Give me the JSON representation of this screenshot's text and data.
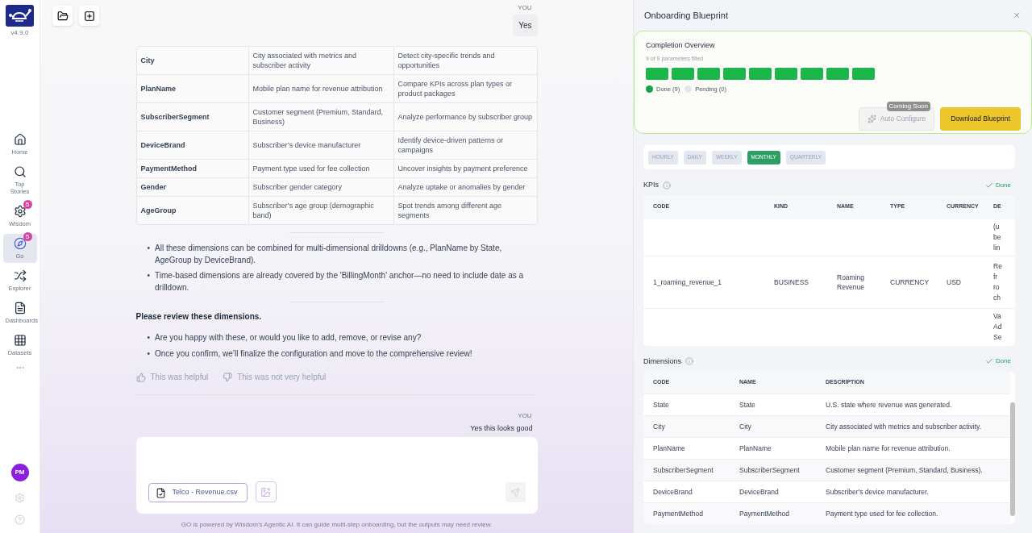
{
  "sidebar": {
    "version": "v4.9.0",
    "nav": [
      {
        "label": "Home",
        "selected": false
      },
      {
        "label": "Top Stories",
        "selected": false
      },
      {
        "label": "Wisdom",
        "badge": "5",
        "selected": false
      },
      {
        "label": "Go",
        "badge": "5",
        "selected": true
      },
      {
        "label": "Explorer",
        "selected": false
      },
      {
        "label": "Dashboards",
        "selected": false
      },
      {
        "label": "Datasets",
        "selected": false
      }
    ],
    "avatar": "PM"
  },
  "chat": {
    "first_message": {
      "sender": "YOU",
      "text": "Yes"
    },
    "table": {
      "rows": [
        [
          "City",
          "City associated with metrics and subscriber activity",
          "Detect city-specific trends and opportunities"
        ],
        [
          "PlanName",
          "Mobile plan name for revenue attribution",
          "Compare KPIs across plan types or product packages"
        ],
        [
          "SubscriberSegment",
          "Customer segment (Premium, Standard, Business)",
          "Analyze performance by subscriber group"
        ],
        [
          "DeviceBrand",
          "Subscriber’s device manufacturer",
          "Identify device-driven patterns or campaigns"
        ],
        [
          "PaymentMethod",
          "Payment type used for fee collection",
          "Uncover insights by payment preference"
        ],
        [
          "Gender",
          "Subscriber gender category",
          "Analyze uptake or anomalies by gender"
        ],
        [
          "AgeGroup",
          "Subscriber’s age group (demographic band)",
          "Spot trends among different age segments"
        ]
      ]
    },
    "notes": [
      {
        "marker": "•",
        "text": "All these dimensions can be combined for multi-dimensional drilldowns (e.g., PlanName by State, AgeGroup by DeviceBrand)."
      },
      {
        "marker": "•",
        "text": "Time-based dimensions are already covered by the 'BillingMonth' anchor—no need to include date as a drilldown."
      }
    ],
    "review_heading": "Please review these dimensions.",
    "review_points": [
      {
        "marker": "•",
        "text": "Are you happy with these, or would you like to add, remove, or revise any?"
      },
      {
        "marker": "•",
        "text": "Once you confirm, we’ll finalize the configuration and move to the comprehensive review!"
      }
    ],
    "feedback": [
      {
        "label": "This was helpful"
      },
      {
        "label": "This was not very helpful"
      }
    ],
    "last_message": {
      "sender": "YOU",
      "text": "Yes this looks good"
    }
  },
  "composer": {
    "attachment": "Telco - Revenue.csv",
    "send_disabled": true
  },
  "footer": "GO is powered by Wisdom’s Agentic AI. It can guide multi-step onboarding, but the outputs may need review.",
  "panel": {
    "title": "Onboarding Blueprint",
    "completion": {
      "title": "Completion Overview",
      "subtitle": "9 of 9 parameters filled",
      "segments": [
        {
          "done": true
        },
        {
          "done": true
        },
        {
          "done": true
        },
        {
          "done": true
        },
        {
          "done": true
        },
        {
          "done": true
        },
        {
          "done": true
        },
        {
          "done": true
        },
        {
          "done": true
        }
      ],
      "legend": [
        {
          "label": "Done (9)",
          "color": "#16a34a"
        },
        {
          "label": "Pending (0)",
          "color": "#e5e7eb"
        }
      ],
      "auto_configure": {
        "label": "Auto Configure",
        "badge": "Coming Soon",
        "disabled": true
      },
      "download": {
        "label": "Download Blueprint"
      }
    },
    "granularity": [
      {
        "label": "HOURLY",
        "selected": false
      },
      {
        "label": "DAILY",
        "selected": false
      },
      {
        "label": "WEEKLY",
        "selected": false
      },
      {
        "label": "MONTHLY",
        "selected": true
      },
      {
        "label": "QUARTERLY",
        "selected": false
      }
    ],
    "kpis": {
      "title": "KPIs",
      "status": "Done",
      "columns": [
        "CODE",
        "KIND",
        "NAME",
        "TYPE",
        "CURRENCY",
        "DE"
      ],
      "rows": [
        {
          "description": [
            "(u",
            "be",
            "lin"
          ]
        },
        {
          "code": "1_roaming_revenue_1",
          "kind": "BUSINESS",
          "name": "Roaming Revenue",
          "type": "CURRENCY",
          "currency": "USD",
          "description": [
            "Re",
            "fr",
            "ro",
            "ch"
          ]
        },
        {
          "description": [
            "Va",
            "Ad",
            "Se"
          ]
        }
      ]
    },
    "dimensions": {
      "title": "Dimensions",
      "status": "Done",
      "columns": [
        "CODE",
        "NAME",
        "DESCRIPTION"
      ],
      "rows": [
        [
          "State",
          "State",
          "U.S. state where revenue was generated."
        ],
        [
          "City",
          "City",
          "City associated with metrics and subscriber activity."
        ],
        [
          "PlanName",
          "PlanName",
          "Mobile plan name for revenue attribution."
        ],
        [
          "SubscriberSegment",
          "SubscriberSegment",
          "Customer segment (Premium, Standard, Business)."
        ],
        [
          "DeviceBrand",
          "DeviceBrand",
          "Subscriber's device manufacturer."
        ],
        [
          "PaymentMethod",
          "PaymentMethod",
          "Payment type used for fee collection."
        ]
      ]
    }
  }
}
